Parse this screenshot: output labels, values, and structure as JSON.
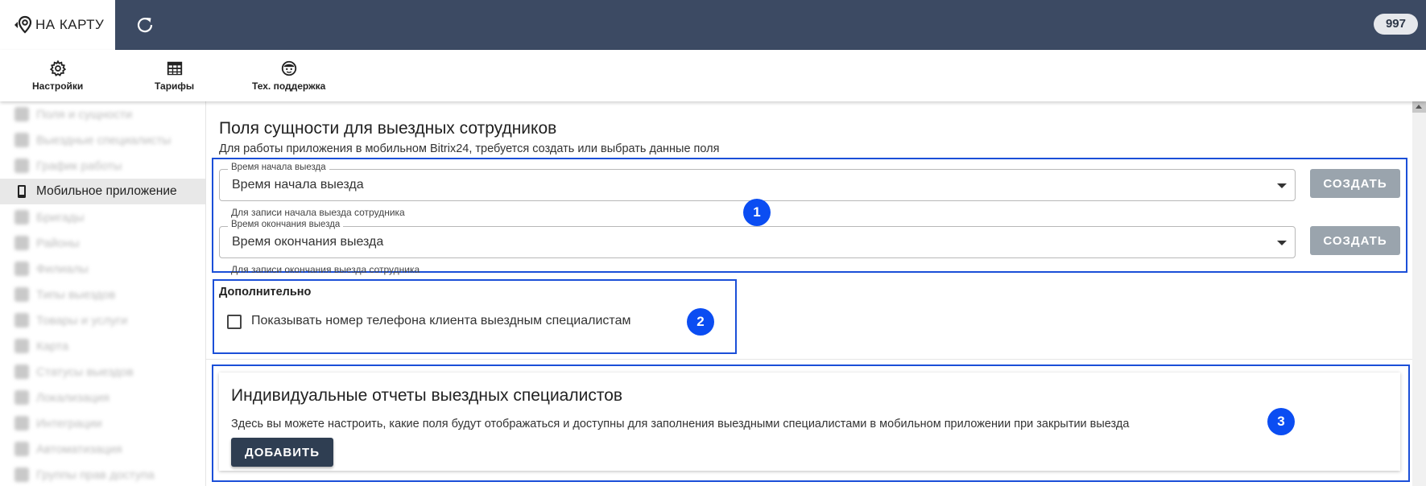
{
  "header": {
    "logo_text": "НА КАРТУ",
    "counter": "997"
  },
  "toolbar": {
    "items": [
      {
        "label": "Настройки",
        "icon": "gear-icon"
      },
      {
        "label": "Тарифы",
        "icon": "table-icon"
      },
      {
        "label": "Тех. поддержка",
        "icon": "support-icon"
      }
    ]
  },
  "sidebar": {
    "items": [
      {
        "label": "Поля и сущности"
      },
      {
        "label": "Выездные специалисты"
      },
      {
        "label": "График работы"
      },
      {
        "label": "Мобильное приложение",
        "active": true
      },
      {
        "label": "Бригады"
      },
      {
        "label": "Районы"
      },
      {
        "label": "Филиалы"
      },
      {
        "label": "Типы выездов"
      },
      {
        "label": "Товары и услуги"
      },
      {
        "label": "Карта"
      },
      {
        "label": "Статусы выездов"
      },
      {
        "label": "Локализация"
      },
      {
        "label": "Интеграции"
      },
      {
        "label": "Автоматизация"
      },
      {
        "label": "Группы прав доступа"
      }
    ]
  },
  "main": {
    "title": "Поля сущности для выездных сотрудников",
    "subtitle": "Для работы приложения в мобильном Bitrix24, требуется создать или выбрать данные поля",
    "fields": [
      {
        "legend": "Время начала выезда",
        "value": "Время начала выезда",
        "helper": "Для записи начала выезда сотрудника",
        "button": "СОЗДАТЬ"
      },
      {
        "legend": "Время окончания выезда",
        "value": "Время окончания выезда",
        "helper": "Для записи окончания выезда сотрудника",
        "button": "СОЗДАТЬ"
      }
    ],
    "extra": {
      "label": "Дополнительно",
      "checkbox_label": "Показывать номер телефона клиента выездным специалистам",
      "checked": false
    },
    "reports": {
      "title": "Индивидуальные отчеты выездных специалистов",
      "text": "Здесь вы можете настроить, какие поля будут отображаться и доступны для заполнения выездными специалистами в мобильном приложении при закрытии выезда",
      "button": "ДОБАВИТЬ"
    }
  },
  "annotations": [
    "1",
    "2",
    "3"
  ],
  "colors": {
    "topbar": "#3c4a63",
    "annotation_blue": "#0b4df2",
    "create_button": "#9aa4ad",
    "add_button": "#2f3e52"
  }
}
